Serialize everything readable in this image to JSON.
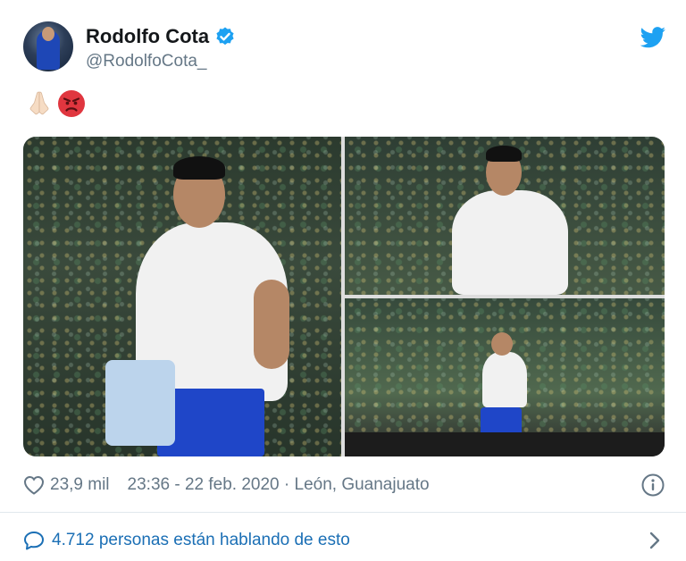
{
  "tweet": {
    "author": {
      "display_name": "Rodolfo Cota",
      "handle": "@RodolfoCota_",
      "verified": true
    },
    "text_emojis": [
      "folded-hands",
      "angry-face"
    ],
    "media": {
      "photo_count": 3
    },
    "likes": "23,9 mil",
    "timestamp": "23:36 - 22 feb. 2020 · León, Guanajuato",
    "conversation": "4.712 personas están hablando de esto"
  },
  "colors": {
    "twitter_blue": "#1da1f2",
    "link_blue": "#1b6fb5",
    "secondary_text": "#657786",
    "divider": "#e1e8ed"
  },
  "icons": {
    "like": "heart-icon",
    "info": "info-icon",
    "conversation": "speech-bubble-icon",
    "more": "chevron-right-icon",
    "brand": "twitter-bird-icon",
    "verified": "verified-badge-icon"
  }
}
